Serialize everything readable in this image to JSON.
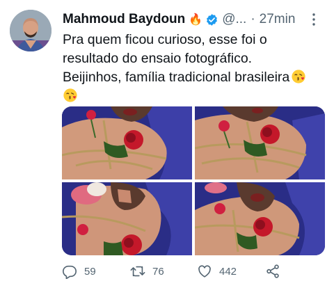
{
  "author": {
    "name": "Mahmoud Baydoun",
    "fire_emoji": "🔥",
    "handle": "@...",
    "separator": "·",
    "time": "27min"
  },
  "tweet": {
    "lines": [
      "Pra quem ficou curioso, esse foi o",
      "resultado do ensaio fotográfico.",
      "Beijinhos, família tradicional brasileira"
    ]
  },
  "media": {
    "photo_count": 4
  },
  "actions": {
    "replies": "59",
    "retweets": "76",
    "likes": "442"
  },
  "colors": {
    "text": "#0f1419",
    "secondary": "#536471",
    "verified": "#1d9bf0"
  },
  "icons": [
    "fire-icon",
    "verified-icon",
    "more-icon",
    "kiss-emoji-icon",
    "reply-icon",
    "retweet-icon",
    "like-icon",
    "share-icon"
  ]
}
